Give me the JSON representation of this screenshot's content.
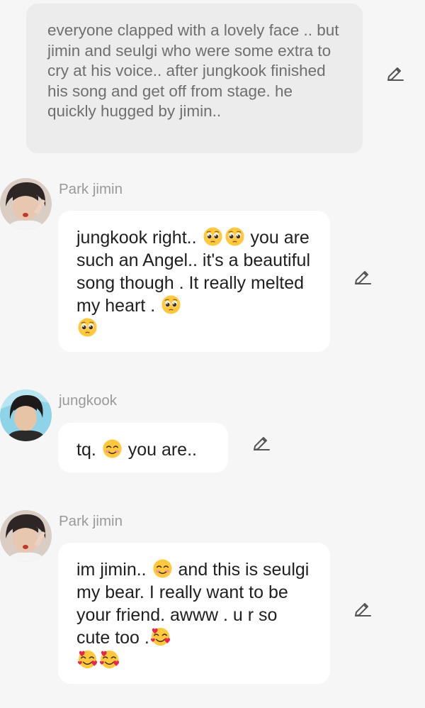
{
  "narration": {
    "text": "everyone clapped with a lovely face .. but jimin and seulgi who were some extra to cry at his voice.. after jungkook finished his song and get off from stage.  he quickly hugged by jimin.."
  },
  "messages": [
    {
      "sender": "Park jimin",
      "text_parts": [
        "jungkook right.. ",
        " you are such an Angel.. it's a beautiful song though . It really melted my heart . "
      ],
      "emojis": [
        "pleading-face-emoji",
        "pleading-face-emoji",
        "pleading-face-emoji",
        "pleading-face-emoji"
      ]
    },
    {
      "sender": "jungkook",
      "text_parts": [
        "tq.  ",
        " you are.."
      ],
      "emojis": [
        "smiling-face-emoji"
      ]
    },
    {
      "sender": "Park jimin",
      "text_parts": [
        "im jimin.. ",
        " and this is seulgi my bear.  I really want to be your friend. awww . u r so cute too ."
      ],
      "emojis": [
        "smiling-face-emoji",
        "smiling-face-with-hearts-emoji",
        "smiling-face-with-hearts-emoji",
        "smiling-face-with-hearts-emoji"
      ]
    }
  ],
  "icons": {
    "edit": "pencil-edit-icon"
  },
  "colors": {
    "background": "#f6f6f6",
    "narration_bubble": "#ececec",
    "message_bubble": "#ffffff",
    "sender_name": "#9a9a9a"
  }
}
